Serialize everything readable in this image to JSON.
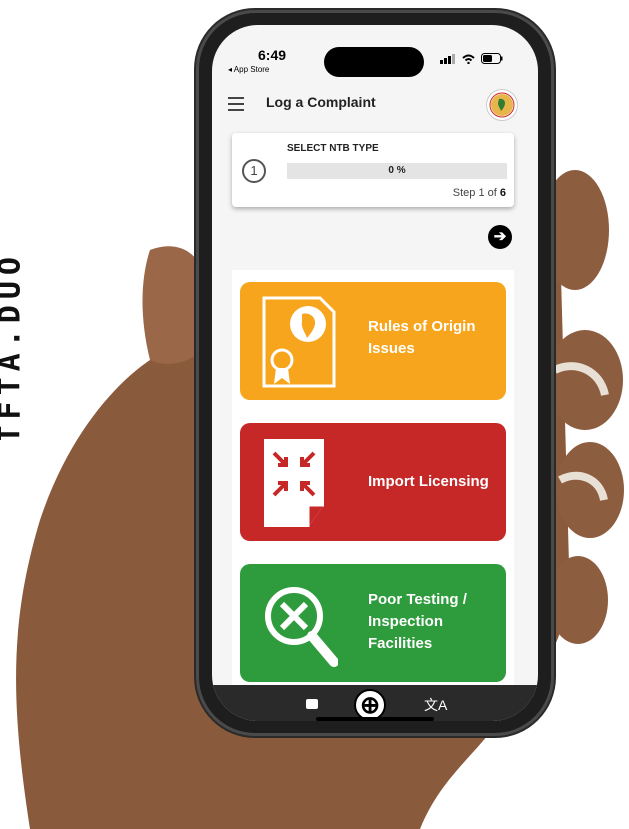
{
  "side_banner": {
    "text": "TFTA.DUO"
  },
  "status_bar": {
    "time": "6:49",
    "back_label": "◂ App Store"
  },
  "app_bar": {
    "title": "Log a Complaint",
    "logo_icon": "organization-logo-icon",
    "menu_icon": "hamburger-menu-icon"
  },
  "progress": {
    "step_number": "1",
    "title": "SELECT NTB TYPE",
    "percent_label": "0 %",
    "percent_value": 0,
    "step_prefix": "Step 1 of ",
    "step_total": "6"
  },
  "next_button": {
    "icon": "arrow-right-icon",
    "glyph": "➔"
  },
  "tiles": [
    {
      "label_line1": "Rules of Origin",
      "label_line2": "Issues",
      "color": "#f7a51c",
      "icon": "certificate-globe-icon"
    },
    {
      "label_line1": "Import Licensing",
      "label_line2": "",
      "color": "#c62828",
      "icon": "import-document-icon"
    },
    {
      "label_line1": "Poor Testing /",
      "label_line2": "Inspection",
      "label_line3": "Facilities",
      "color": "#2e9b3d",
      "icon": "inspection-magnifier-icon"
    }
  ],
  "bottom_nav": {
    "search_icon": "search-icon",
    "add_glyph": "⊕",
    "translate_glyph": "文A"
  },
  "colors": {
    "accent_progress": "#3a8f3a",
    "appbar_bg": "#f5f5f5"
  }
}
